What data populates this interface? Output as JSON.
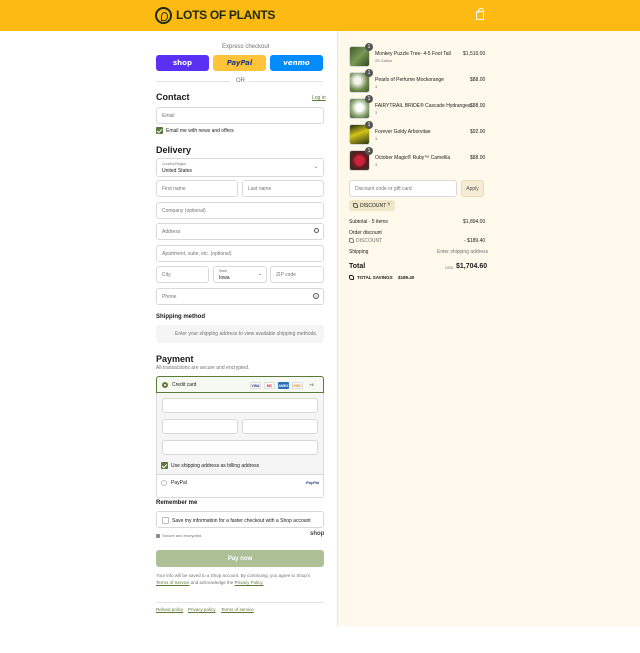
{
  "header": {
    "brand": "LOTS OF PLANTS",
    "logo_icon": "lop-logo-icon",
    "cart_icon": "bag-icon",
    "accent": "#FDBA12"
  },
  "express": {
    "title": "Express checkout",
    "shop_label": "shop",
    "paypal_label": "PayPal",
    "venmo_label": "venmo",
    "or_label": "OR"
  },
  "contact": {
    "title": "Contact",
    "login_label": "Log in",
    "email_placeholder": "Email",
    "newsletter_label": "Email me with news and offers",
    "newsletter_checked": true
  },
  "delivery": {
    "title": "Delivery",
    "country_label": "Country/Region",
    "country_value": "United States",
    "first_name_placeholder": "First name",
    "last_name_placeholder": "Last name",
    "company_placeholder": "Company (optional)",
    "address_placeholder": "Address",
    "apartment_placeholder": "Apartment, suite, etc. (optional)",
    "city_placeholder": "City",
    "state_label": "State",
    "state_value": "Iowa",
    "zip_placeholder": "ZIP code",
    "phone_placeholder": "Phone"
  },
  "shipping_method": {
    "title": "Shipping method",
    "notice": "Enter your shipping address to view available shipping methods."
  },
  "payment": {
    "title": "Payment",
    "subtitle": "All transactions are secure and encrypted.",
    "credit_card_label": "Credit card",
    "card_brands": [
      "VISA",
      "MC",
      "AMEX",
      "DISC"
    ],
    "more_cards": "+4",
    "billing_label": "Use shipping address as billing address",
    "paypal_label": "PayPal"
  },
  "remember": {
    "title": "Remember me",
    "save_label": "Save my information for a faster checkout with a Shop account",
    "secure_label": "Secure and encrypted",
    "shop_label": "shop"
  },
  "pay_button": "Pay now",
  "legal": {
    "text1": "Your info will be saved to a Shop account. By continuing, you agree to Shop's",
    "terms": "Terms of Service",
    "text2": "and acknowledge the",
    "privacy": "Privacy Policy."
  },
  "footer_links": [
    "Refund policy",
    "Privacy policy",
    "Terms of service"
  ],
  "summary": {
    "items": [
      {
        "name": "Monkey Puzzle Tree- 4-5 Foot Tall",
        "variant": "25 Gallon",
        "qty": "1",
        "price": "$1,510.00"
      },
      {
        "name": "Pearls of Perfume Mockorange",
        "variant": "3",
        "qty": "1",
        "price": "$88.00"
      },
      {
        "name": "FAIRYTRAIL BRIDE® Cascade Hydrangea",
        "variant": "3",
        "qty": "1",
        "price": "$88.00"
      },
      {
        "name": "Forever Goldy Arborvitae",
        "variant": "3",
        "qty": "1",
        "price": "$92.00"
      },
      {
        "name": "October Magic® Ruby™ Camellia",
        "variant": "3",
        "qty": "1",
        "price": "$88.00"
      }
    ],
    "discount_placeholder": "Discount code or gift card",
    "apply_label": "Apply",
    "discount_tag": "DISCOUNT",
    "subtotal_label": "Subtotal · 5 items",
    "subtotal_value": "$1,894.00",
    "order_discount_label": "Order discount",
    "discount_code": "DISCOUNT",
    "discount_value": "- $189.40",
    "shipping_label": "Shipping",
    "shipping_value": "Enter shipping address",
    "total_label": "Total",
    "currency": "USD",
    "total_value": "$1,704.60",
    "savings_label": "TOTAL SAVINGS",
    "savings_value": "$189.40"
  }
}
